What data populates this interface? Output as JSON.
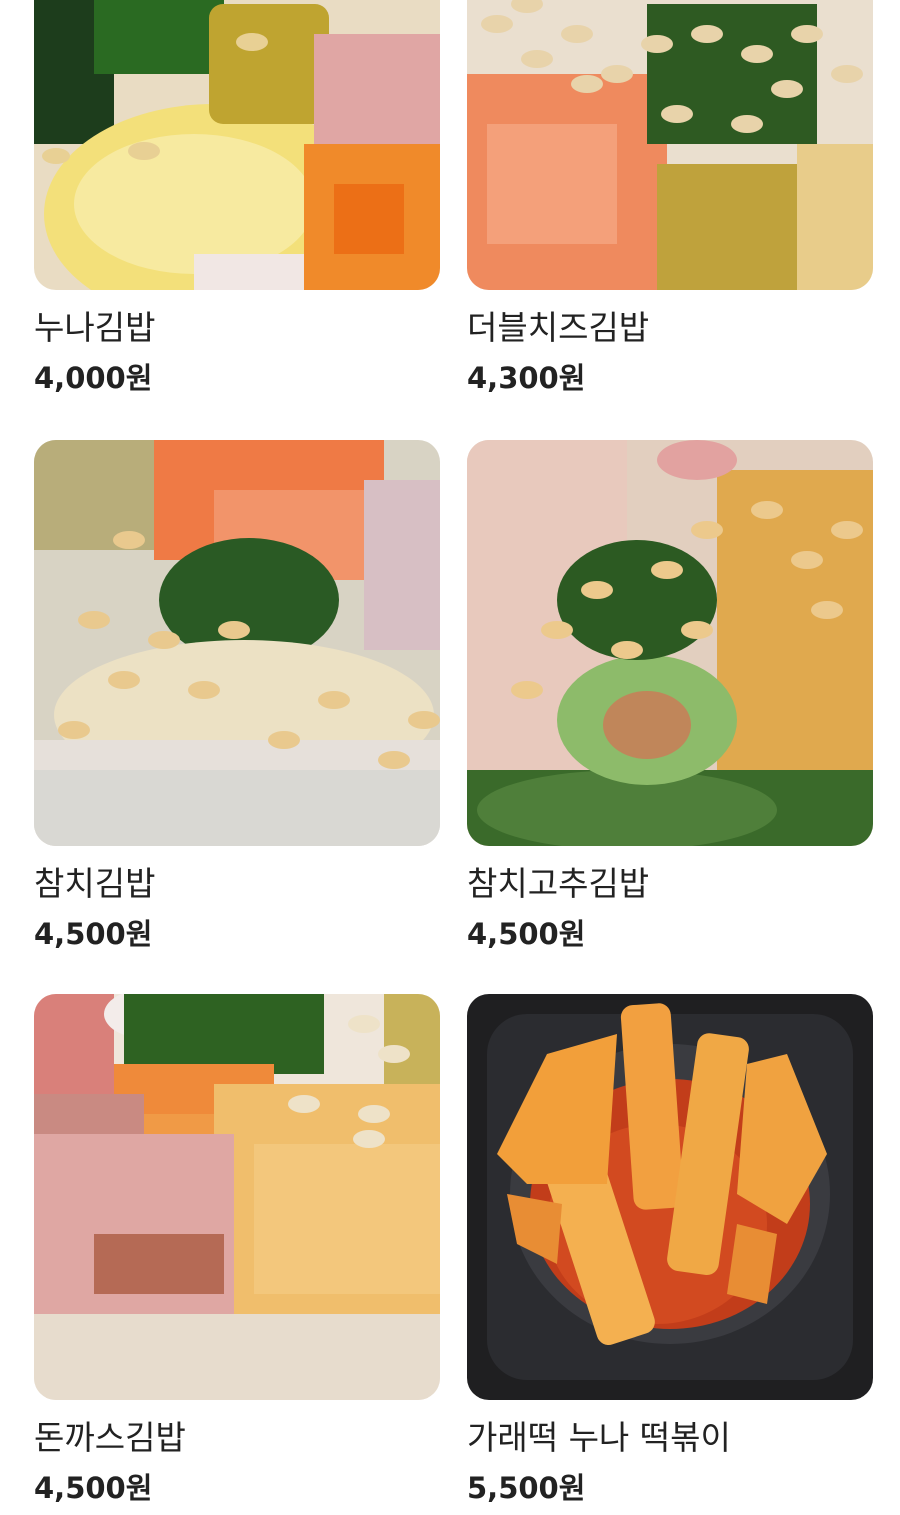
{
  "menu": {
    "items": [
      {
        "name": "누나김밥",
        "price": "4,000원",
        "image": "gimbap-photo"
      },
      {
        "name": "더블치즈김밥",
        "price": "4,300원",
        "image": "gimbap-photo"
      },
      {
        "name": "참치김밥",
        "price": "4,500원",
        "image": "gimbap-photo"
      },
      {
        "name": "참치고추김밥",
        "price": "4,500원",
        "image": "gimbap-photo"
      },
      {
        "name": "돈까스김밥",
        "price": "4,500원",
        "image": "gimbap-photo"
      },
      {
        "name": "가래떡 누나 떡볶이",
        "price": "5,500원",
        "image": "tteokbokki-photo"
      }
    ]
  }
}
